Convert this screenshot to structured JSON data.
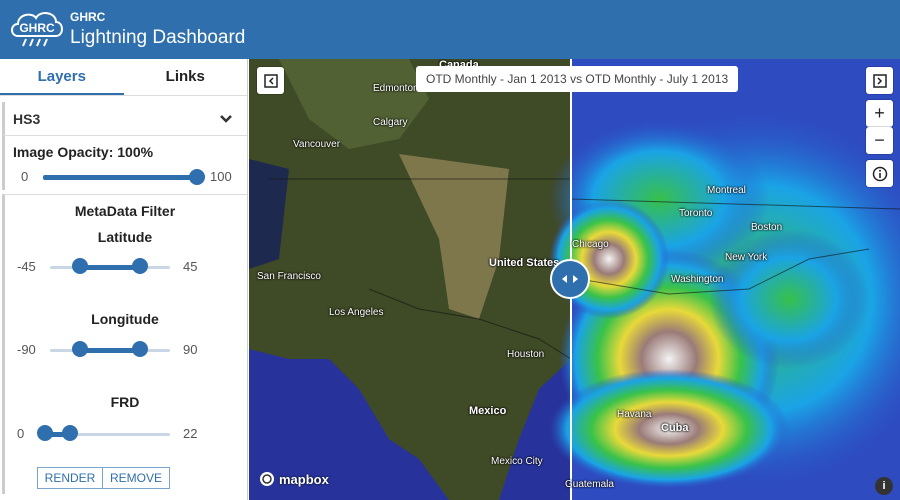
{
  "header": {
    "logo_text": "GHRC",
    "org": "GHRC",
    "title": "Lightning Dashboard"
  },
  "tabs": [
    {
      "label": "Layers",
      "active": true
    },
    {
      "label": "Links",
      "active": false
    }
  ],
  "dataset": {
    "selected": "HS3"
  },
  "opacity": {
    "label": "Image Opacity: 100%",
    "min": "0",
    "max": "100",
    "value_fraction": 1.0
  },
  "filter": {
    "title": "MetaData Filter",
    "latitude": {
      "label": "Latitude",
      "min": "-45",
      "max": "45",
      "low_fraction": 0.25,
      "high_fraction": 0.75
    },
    "longitude": {
      "label": "Longitude",
      "min": "-90",
      "max": "90",
      "low_fraction": 0.25,
      "high_fraction": 0.75
    },
    "frd": {
      "label": "FRD",
      "min": "0",
      "max": "22",
      "low_fraction": 0.0,
      "high_fraction": 0.2
    },
    "render_label": "RENDER",
    "remove_label": "REMOVE"
  },
  "map": {
    "compare_label": "OTD Monthly - Jan 1 2013 vs OTD Monthly - July 1 2013",
    "zoom_in": "+",
    "zoom_out": "−",
    "attribution": "mapbox",
    "cities": [
      {
        "name": "Canada",
        "kind": "country"
      },
      {
        "name": "Edmonton",
        "kind": "city"
      },
      {
        "name": "Calgary",
        "kind": "city"
      },
      {
        "name": "Vancouver",
        "kind": "city"
      },
      {
        "name": "San Francisco",
        "kind": "city"
      },
      {
        "name": "Los Angeles",
        "kind": "city"
      },
      {
        "name": "United States",
        "kind": "country"
      },
      {
        "name": "Houston",
        "kind": "city"
      },
      {
        "name": "Mexico",
        "kind": "country"
      },
      {
        "name": "Mexico City",
        "kind": "city"
      },
      {
        "name": "Guatemala",
        "kind": "city"
      },
      {
        "name": "Chicago",
        "kind": "city"
      },
      {
        "name": "Montreal",
        "kind": "city"
      },
      {
        "name": "Toronto",
        "kind": "city"
      },
      {
        "name": "Boston",
        "kind": "city"
      },
      {
        "name": "New York",
        "kind": "city"
      },
      {
        "name": "Washington",
        "kind": "city"
      },
      {
        "name": "Havana",
        "kind": "city"
      },
      {
        "name": "Cuba",
        "kind": "country"
      }
    ]
  },
  "colors": {
    "brand": "#2f6fae",
    "ocean": "#27339a",
    "land": "#3f4a26"
  }
}
